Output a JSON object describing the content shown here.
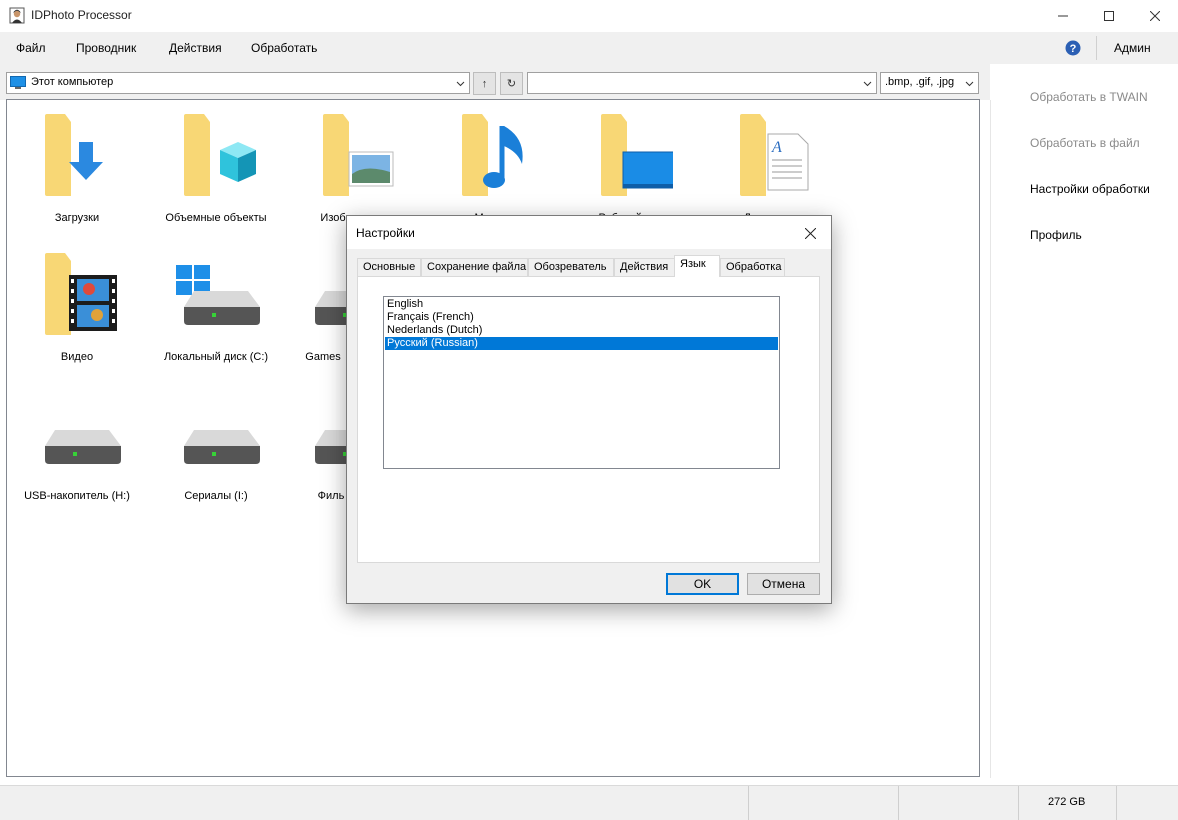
{
  "window": {
    "title": "IDPhoto Processor"
  },
  "menu": {
    "items": [
      "Файл",
      "Проводник",
      "Действия",
      "Обработать"
    ],
    "user": "Админ"
  },
  "toolbar": {
    "path": "Этот компьютер",
    "up_symbol": "↑",
    "refresh_symbol": "↻",
    "filter_value": "",
    "extensions": ".bmp, .gif, .jpg"
  },
  "explorer": {
    "items": [
      {
        "label": "Загрузки",
        "icon": "downloads-folder-icon"
      },
      {
        "label": "Объемные объекты",
        "icon": "3d-objects-folder-icon"
      },
      {
        "label": "Изображения",
        "icon": "pictures-folder-icon"
      },
      {
        "label": "Музыка",
        "icon": "music-folder-icon"
      },
      {
        "label": "Рабочий стол",
        "icon": "desktop-folder-icon"
      },
      {
        "label": "Документы",
        "icon": "documents-folder-icon"
      },
      {
        "label": "Видео",
        "icon": "videos-folder-icon"
      },
      {
        "label": "Локальный диск (C:)",
        "icon": "windows-drive-icon"
      },
      {
        "label": "Games",
        "icon": "drive-icon"
      },
      {
        "label": "USB-накопитель (H:)",
        "icon": "drive-icon"
      },
      {
        "label": "Сериалы (I:)",
        "icon": "drive-icon"
      },
      {
        "label": "Филь",
        "icon": "drive-icon"
      }
    ]
  },
  "actions": {
    "twain": "Обработать в TWAIN",
    "to_file": "Обработать в файл",
    "settings": "Настройки обработки",
    "profile": "Профиль"
  },
  "status": {
    "free_space": "272 GB"
  },
  "dialog": {
    "title": "Настройки",
    "tabs": [
      "Основные",
      "Сохранение файла",
      "Обозреватель",
      "Действия",
      "Язык",
      "Обработка"
    ],
    "active_tab": "Язык",
    "languages": [
      "English",
      "Français (French)",
      "Nederlands (Dutch)",
      "Русский (Russian)"
    ],
    "selected_language": "Русский (Russian)",
    "ok_label": "OK",
    "cancel_label": "Отмена"
  },
  "colors": {
    "accent": "#0078d7",
    "folder_yellow": "#f8d775",
    "folder_dark": "#e8b63a"
  }
}
